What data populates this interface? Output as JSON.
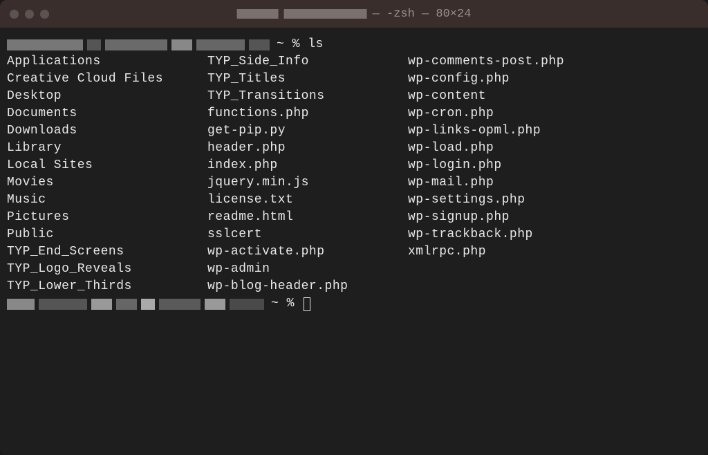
{
  "window": {
    "title_suffix": "— -zsh — 80×24"
  },
  "prompt": {
    "symbol": "~ %",
    "command": "ls"
  },
  "ls_output": {
    "col1": [
      "Applications",
      "Creative Cloud Files",
      "Desktop",
      "Documents",
      "Downloads",
      "Library",
      "Local Sites",
      "Movies",
      "Music",
      "Pictures",
      "Public",
      "TYP_End_Screens",
      "TYP_Logo_Reveals",
      "TYP_Lower_Thirds"
    ],
    "col2": [
      "TYP_Side_Info",
      "TYP_Titles",
      "TYP_Transitions",
      "functions.php",
      "get-pip.py",
      "header.php",
      "index.php",
      "jquery.min.js",
      "license.txt",
      "readme.html",
      "sslcert",
      "wp-activate.php",
      "wp-admin",
      "wp-blog-header.php"
    ],
    "col3": [
      "wp-comments-post.php",
      "wp-config.php",
      "wp-content",
      "wp-cron.php",
      "wp-links-opml.php",
      "wp-load.php",
      "wp-login.php",
      "wp-mail.php",
      "wp-settings.php",
      "wp-signup.php",
      "wp-trackback.php",
      "xmlrpc.php"
    ]
  }
}
